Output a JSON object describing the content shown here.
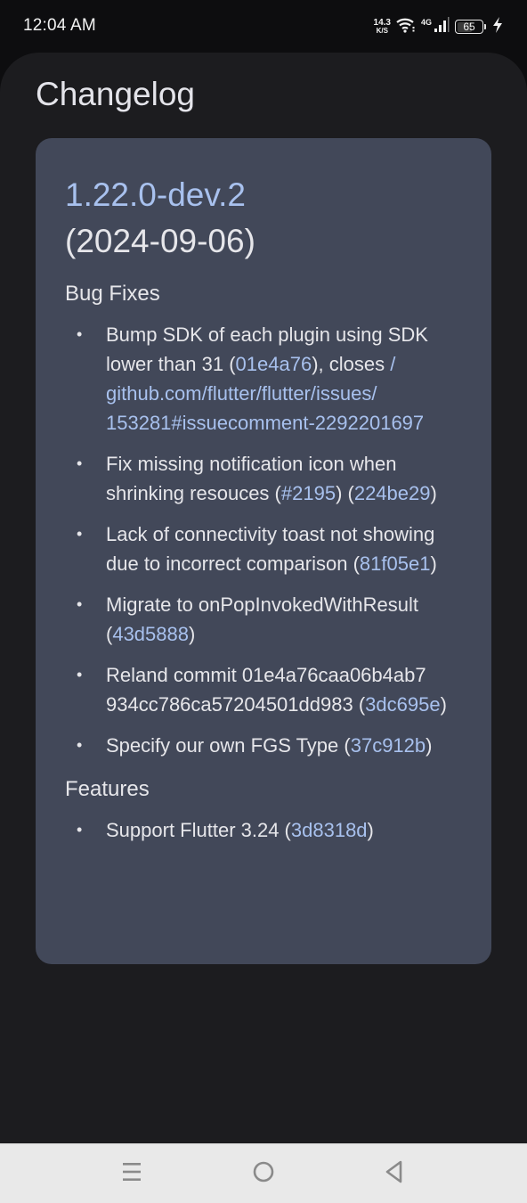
{
  "status_bar": {
    "time": "12:04 AM",
    "net_speed_value": "14.3",
    "net_speed_unit": "K/S",
    "network_type": "4G",
    "battery_level": "65",
    "battery_percent": 65,
    "charging": true,
    "icons": [
      "wifi-icon",
      "signal-icon",
      "battery-icon",
      "charging-icon"
    ]
  },
  "page": {
    "title": "Changelog"
  },
  "release": {
    "version": "1.22.0-dev.2",
    "date": "(2024-09-06)",
    "sections": [
      {
        "title": "Bug Fixes",
        "items": [
          {
            "parts": [
              {
                "text": "Bump SDK of each plugin using SDK lower than 31 (",
                "link": false
              },
              {
                "text": "01e4a76",
                "link": true
              },
              {
                "text": "), closes ",
                "link": false
              },
              {
                "text": "/ github.com/flutter/flutter/issues/ 153281#issuecomment-2292201697",
                "link": true
              }
            ]
          },
          {
            "parts": [
              {
                "text": "Fix missing notification icon when shrinking resouces (",
                "link": false
              },
              {
                "text": "#2195",
                "link": true
              },
              {
                "text": ") (",
                "link": false
              },
              {
                "text": "224be29",
                "link": true
              },
              {
                "text": ")",
                "link": false
              }
            ]
          },
          {
            "parts": [
              {
                "text": "Lack of connectivity toast not showing due to incorrect comparison (",
                "link": false
              },
              {
                "text": "81f05e1",
                "link": true
              },
              {
                "text": ")",
                "link": false
              }
            ]
          },
          {
            "parts": [
              {
                "text": "Migrate to onPopInvokedWithResult (",
                "link": false
              },
              {
                "text": "43d5888",
                "link": true
              },
              {
                "text": ")",
                "link": false
              }
            ]
          },
          {
            "parts": [
              {
                "text": "Reland commit 01e4a76caa06b4ab7 934cc786ca57204501dd983 (",
                "link": false
              },
              {
                "text": "3dc695e",
                "link": true
              },
              {
                "text": ")",
                "link": false
              }
            ]
          },
          {
            "parts": [
              {
                "text": "Specify our own FGS Type (",
                "link": false
              },
              {
                "text": "37c912b",
                "link": true
              },
              {
                "text": ")",
                "link": false
              }
            ]
          }
        ]
      },
      {
        "title": "Features",
        "items": [
          {
            "parts": [
              {
                "text": "Support Flutter 3.24 (",
                "link": false
              },
              {
                "text": "3d8318d",
                "link": true
              },
              {
                "text": ")",
                "link": false
              }
            ]
          }
        ]
      }
    ]
  },
  "nav_bar": {
    "buttons": [
      "recents-button",
      "home-button",
      "back-button"
    ]
  },
  "colors": {
    "link": "#a8c1ee",
    "card_background": "#424859",
    "sheet_background": "#1c1c1f",
    "text": "#e6e6ea"
  }
}
